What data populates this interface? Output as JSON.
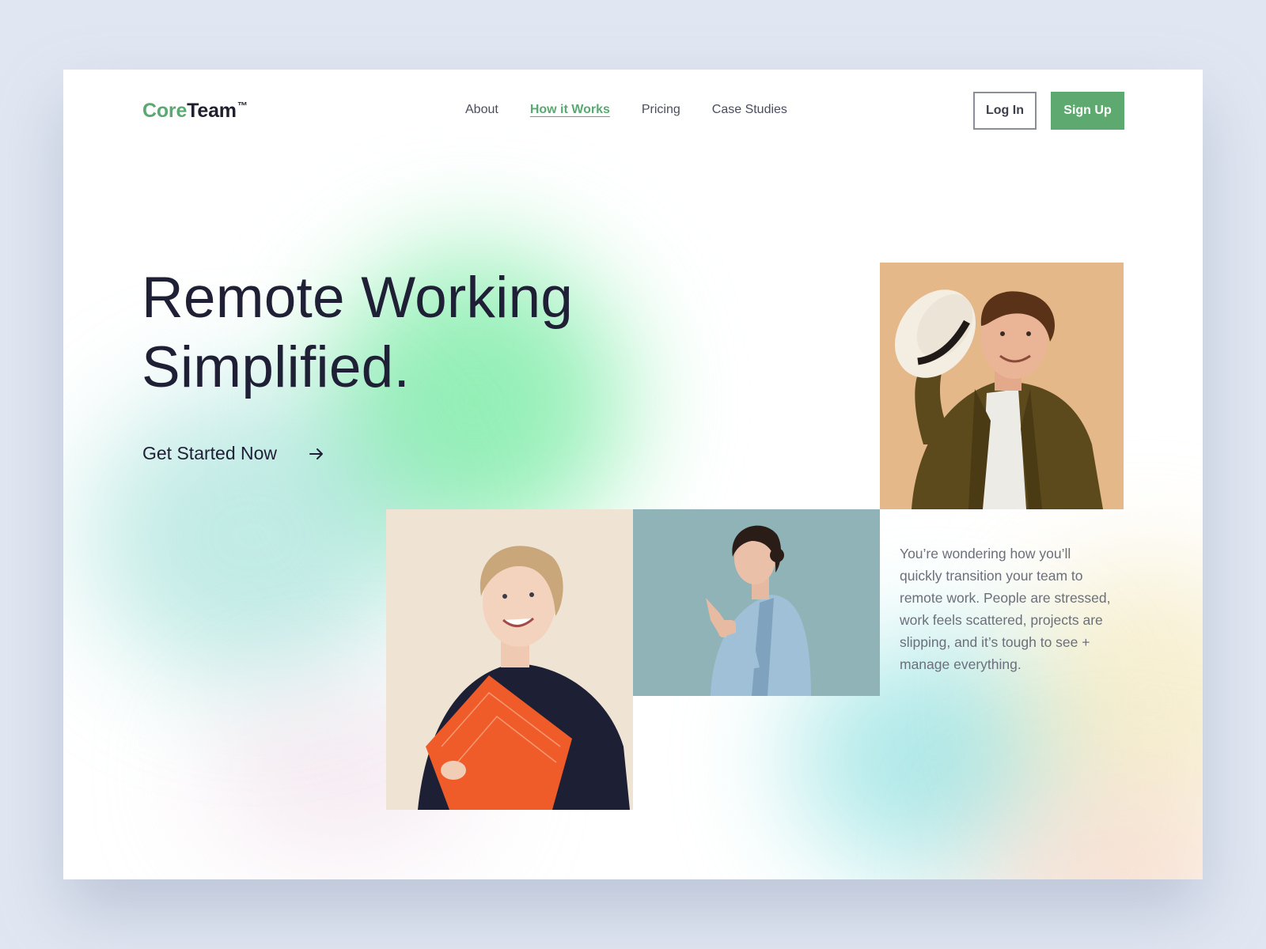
{
  "brand": {
    "name_part1": "Core",
    "name_part2": "Team",
    "trademark": "™",
    "accent_color": "#5aa872"
  },
  "nav": {
    "items": [
      {
        "label": "About",
        "active": false
      },
      {
        "label": "How it Works",
        "active": true
      },
      {
        "label": "Pricing",
        "active": false
      },
      {
        "label": "Case Studies",
        "active": false
      }
    ],
    "login_label": "Log In",
    "signup_label": "Sign Up",
    "signup_color": "#5ea96f"
  },
  "hero": {
    "title_line1": "Remote Working",
    "title_line2": "Simplified.",
    "cta_label": "Get Started Now",
    "cta_icon": "arrow-right-icon",
    "description": "You’re wondering how you’ll quickly transition your team to remote work. People are stressed, work feels scattered, projects are slipping, and it’s tough to see + manage everything."
  },
  "photos": [
    {
      "subject": "smiling man in olive jacket holding a white hat"
    },
    {
      "subject": "smiling blonde woman holding an orange folder"
    },
    {
      "subject": "woman in light blue blazer pointing at camera"
    }
  ]
}
